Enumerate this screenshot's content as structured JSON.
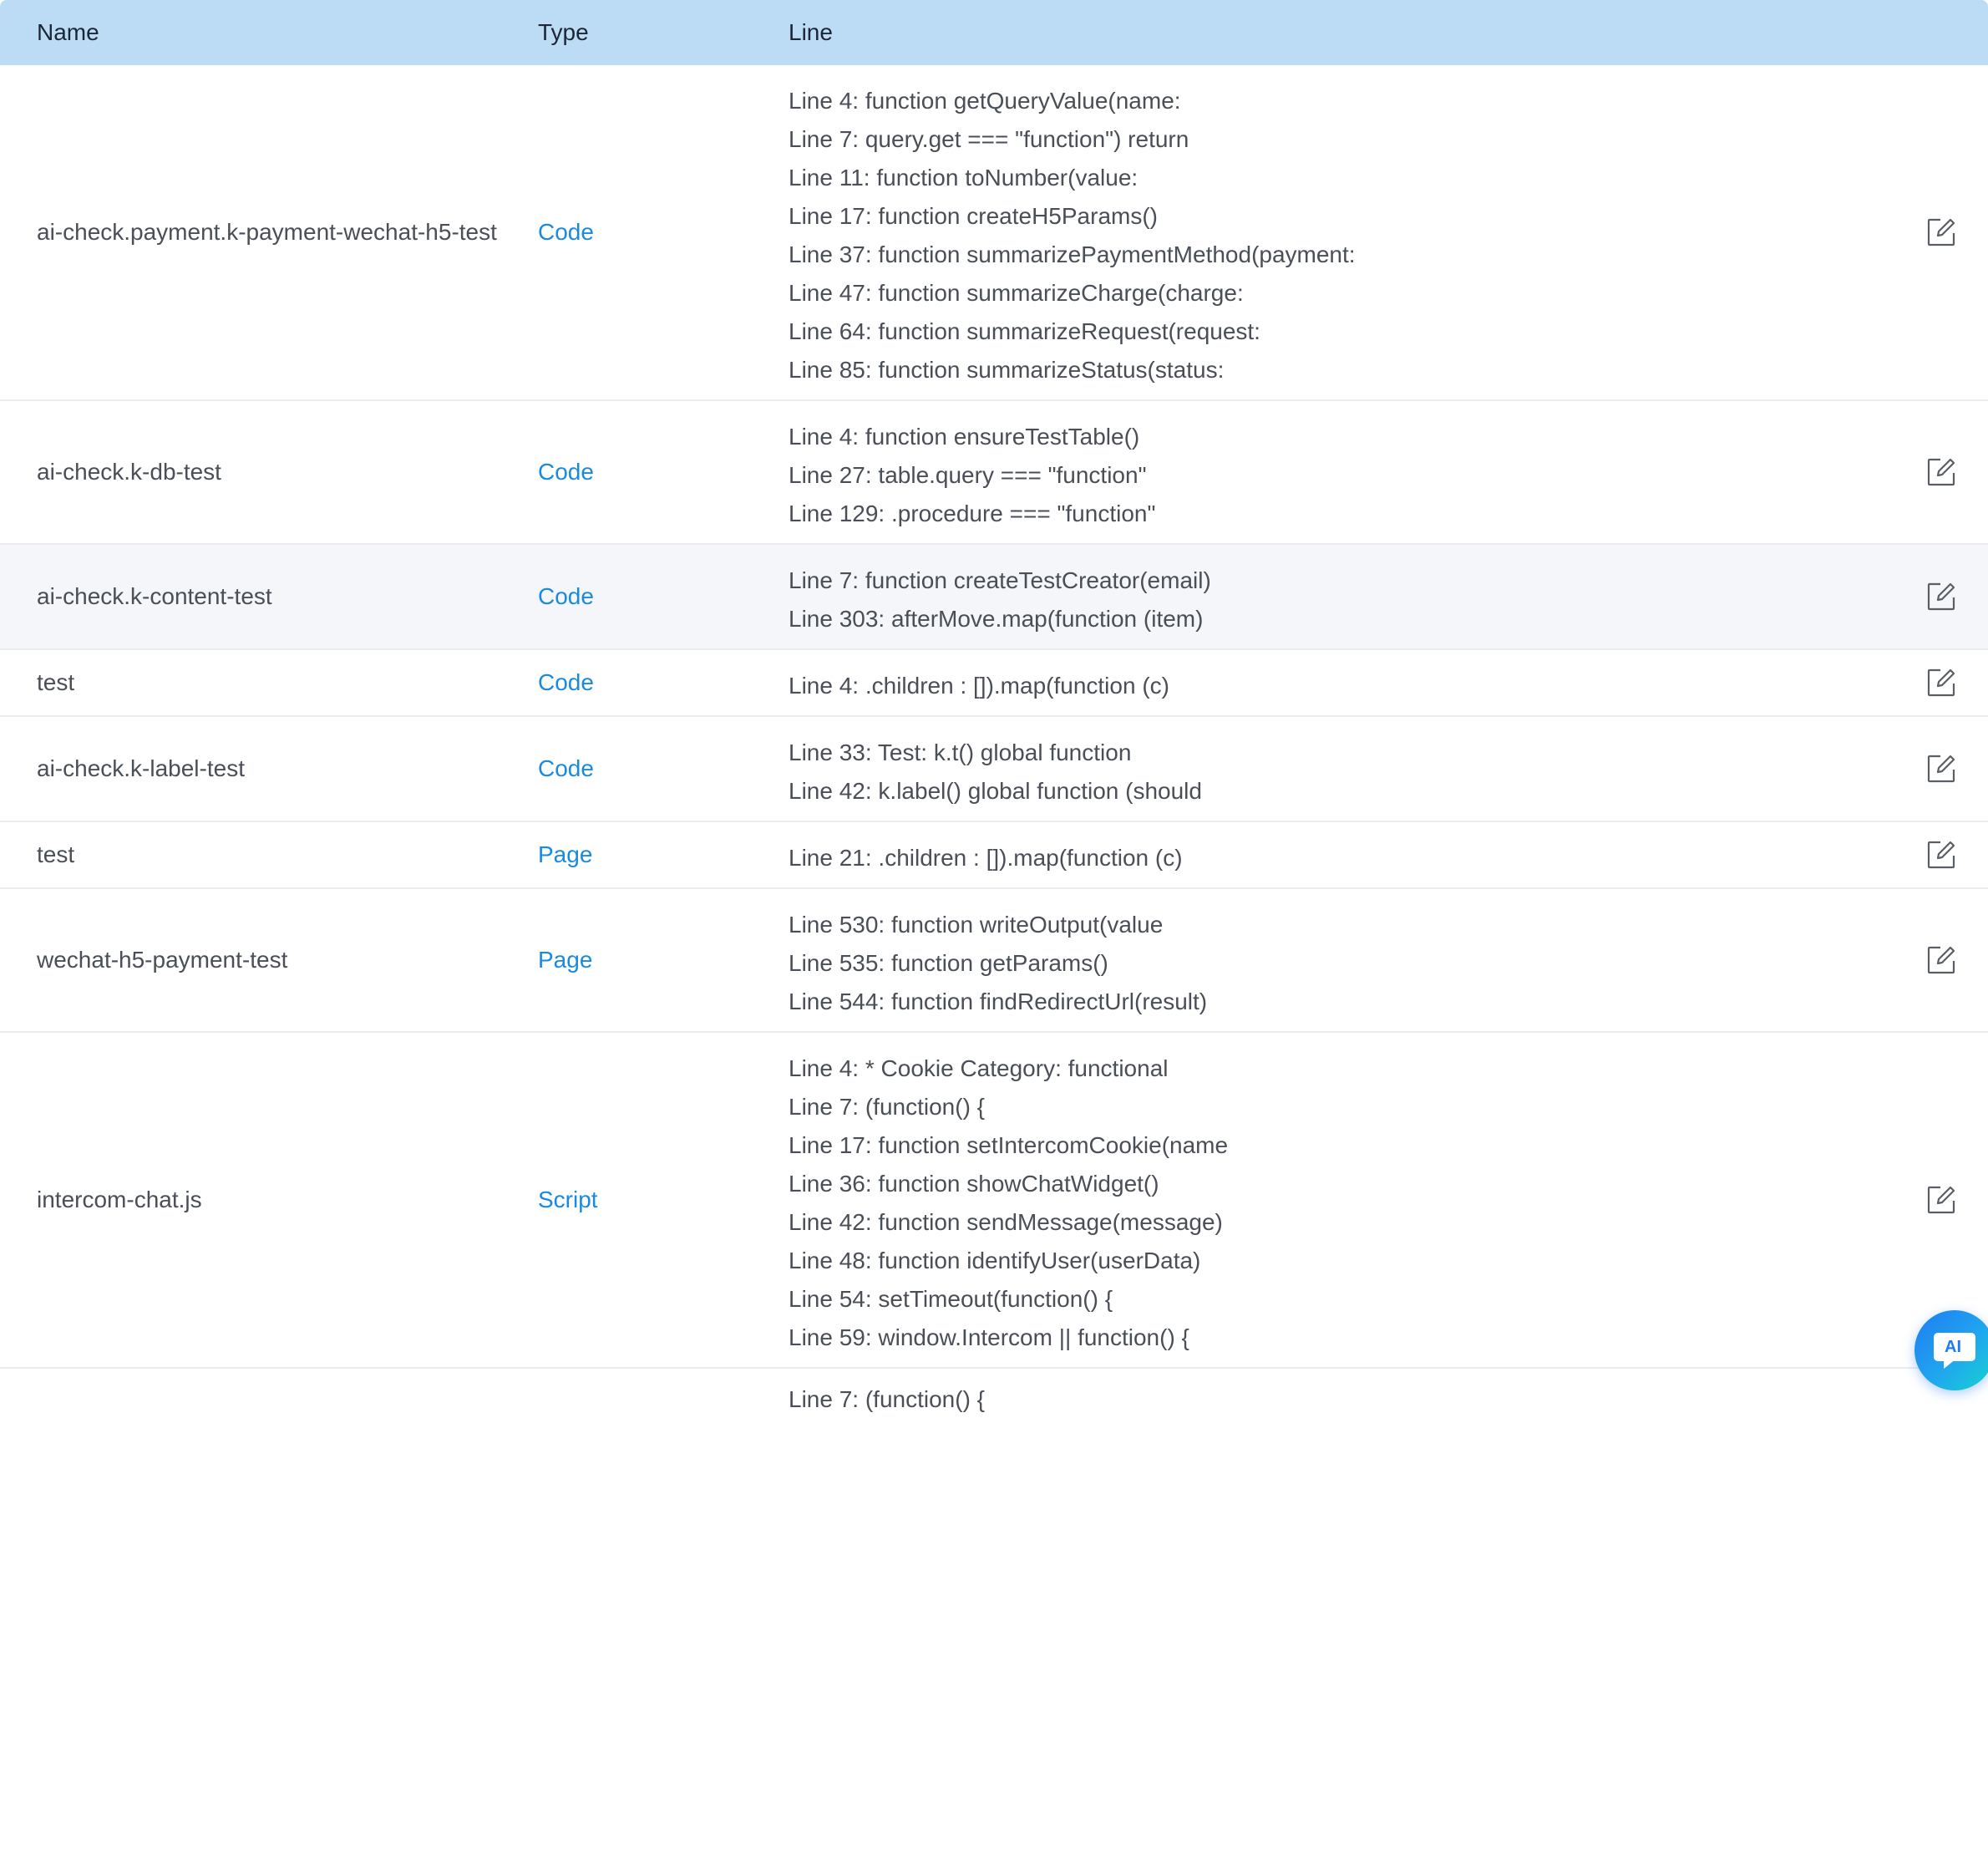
{
  "header": {
    "name": "Name",
    "type": "Type",
    "line": "Line"
  },
  "rows": [
    {
      "name": "ai-check.payment.k-payment-wechat-h5-test",
      "type": "Code",
      "lines": [
        "Line 4: function getQueryValue(name:",
        "Line 7: query.get === \"function\") return",
        "Line 11: function toNumber(value:",
        "Line 17: function createH5Params()",
        "Line 37: function summarizePaymentMethod(payment:",
        "Line 47: function summarizeCharge(charge:",
        "Line 64: function summarizeRequest(request:",
        "Line 85: function summarizeStatus(status:"
      ]
    },
    {
      "name": "ai-check.k-db-test",
      "type": "Code",
      "lines": [
        "Line 4: function ensureTestTable()",
        "Line 27: table.query === \"function\"",
        "Line 129: .procedure === \"function\""
      ]
    },
    {
      "name": "ai-check.k-content-test",
      "type": "Code",
      "lines": [
        "Line 7: function createTestCreator(email)",
        "Line 303: afterMove.map(function (item)"
      ]
    },
    {
      "name": "test",
      "type": "Code",
      "lines": [
        "Line 4: .children : []).map(function (c)"
      ]
    },
    {
      "name": "ai-check.k-label-test",
      "type": "Code",
      "lines": [
        "Line 33: Test: k.t() global function",
        "Line 42: k.label() global function (should"
      ]
    },
    {
      "name": "test",
      "type": "Page",
      "lines": [
        "Line 21: .children : []).map(function (c)"
      ]
    },
    {
      "name": "wechat-h5-payment-test",
      "type": "Page",
      "lines": [
        "Line 530: function writeOutput(value",
        "Line 535: function getParams()",
        "Line 544: function findRedirectUrl(result)"
      ]
    },
    {
      "name": "intercom-chat.js",
      "type": "Script",
      "lines": [
        "Line 4: * Cookie Category: functional",
        "Line 7: (function() {",
        "Line 17: function setIntercomCookie(name",
        "Line 36: function showChatWidget()",
        "Line 42: function sendMessage(message)",
        "Line 48: function identifyUser(userData)",
        "Line 54: setTimeout(function() {",
        "Line 59: window.Intercom || function() {"
      ]
    },
    {
      "name": "",
      "type": "",
      "lines": [
        "Line 7: (function() {"
      ]
    }
  ],
  "icons": {
    "edit": "edit-square-icon",
    "ai": "ai-chat-icon"
  },
  "ai_button": {
    "label": "AI"
  },
  "colors": {
    "header_bg": "#bcdcf5",
    "type_link": "#1a8ae0",
    "row_hover": "#f4f6f9",
    "text": "#4a4f57"
  }
}
